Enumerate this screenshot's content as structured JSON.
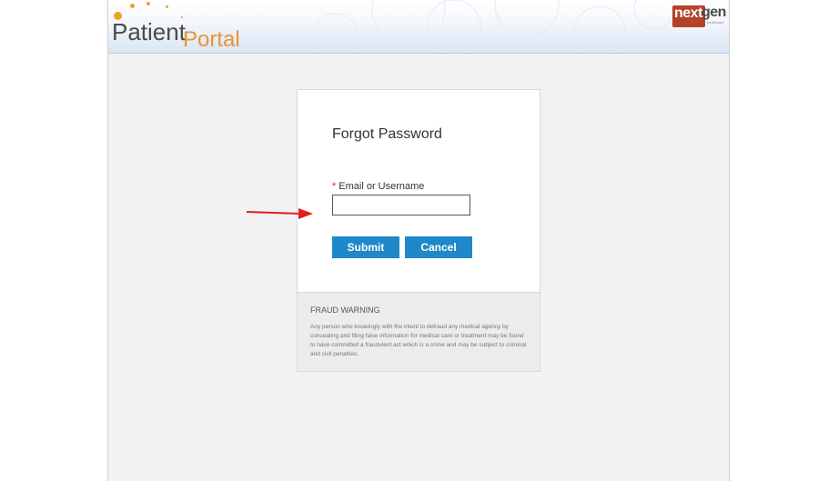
{
  "header": {
    "logo_patient": "Patient",
    "logo_portal": "Portal",
    "brand_next": "next",
    "brand_gen": "gen",
    "brand_sub": "healthcare"
  },
  "form": {
    "title": "Forgot Password",
    "required_mark": "*",
    "field_label": "Email or Username",
    "field_value": "",
    "submit_label": "Submit",
    "cancel_label": "Cancel"
  },
  "fraud_warning": {
    "title": "FRAUD WARNING",
    "text": "Any person who knowingly with the intent to defraud any medical agency by concealing and filing false information for medical care or treatment may be found to have committed a fraudulent act which is a crime and may be subject to criminal and civil penalties."
  },
  "colors": {
    "accent_button": "#1e88c8",
    "annotation_arrow": "#e02020",
    "logo_orange": "#e8952e"
  },
  "icons": {
    "annotation": "red-arrow-icon"
  }
}
